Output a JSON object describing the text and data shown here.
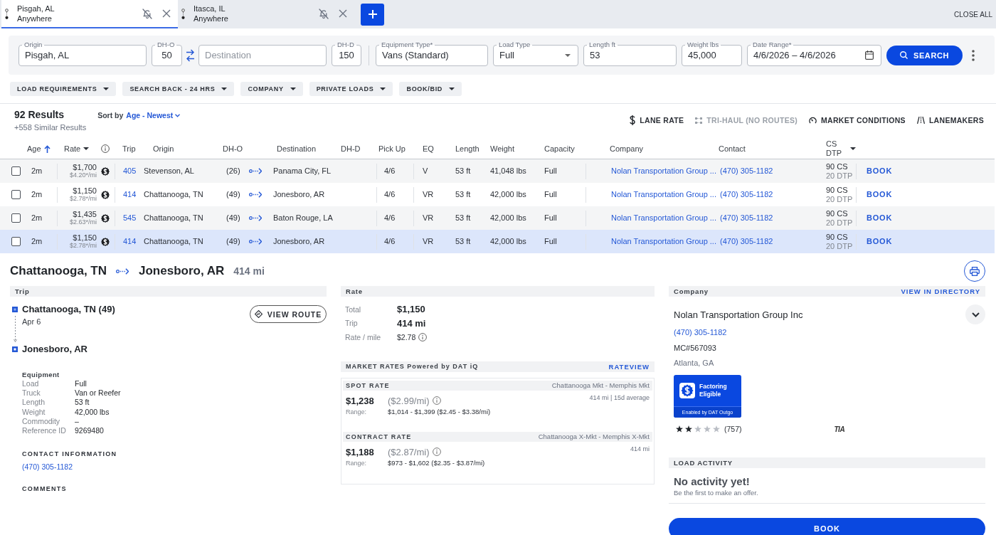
{
  "search_tabs": [
    {
      "origin": "Pisgah, AL",
      "destination": "Anywhere",
      "selected": true
    },
    {
      "origin": "Itasca, IL",
      "destination": "Anywhere",
      "selected": false
    }
  ],
  "close_all": "CLOSE ALL",
  "search_form": {
    "fields": [
      {
        "kind": "text",
        "label": "Origin",
        "value": "Pisgah, AL"
      },
      {
        "kind": "text",
        "label": "DH-O",
        "value": "50"
      },
      {
        "kind": "swap"
      },
      {
        "kind": "text",
        "placeholder": "Destination"
      },
      {
        "kind": "text",
        "label": "DH-D",
        "value": "150"
      },
      {
        "kind": "divider"
      },
      {
        "kind": "text",
        "label": "Equipment Type*",
        "value": "Vans (Standard)"
      },
      {
        "kind": "select",
        "label": "Load Type",
        "value": "Full"
      },
      {
        "kind": "text",
        "label": "Length ft",
        "value": "53"
      },
      {
        "kind": "text",
        "label": "Weight lbs",
        "value": "45,000"
      },
      {
        "kind": "date",
        "label": "Date Range*",
        "value": "4/6/2026 – 4/6/2026"
      }
    ],
    "search_button": "SEARCH"
  },
  "filters": [
    "LOAD REQUIREMENTS",
    "SEARCH BACK - 24 HRS",
    "COMPANY",
    "PRIVATE LOADS",
    "BOOK/BID"
  ],
  "results": {
    "count": "92 Results",
    "similar": "+558 Similar Results",
    "sort_label": "Sort by",
    "sort_value": "Age - Newest"
  },
  "tools": [
    {
      "kind": "dollar",
      "label": "LANE RATE",
      "disabled": false
    },
    {
      "kind": "trihaul",
      "label": "TRI-HAUL (NO ROUTES)",
      "disabled": true
    },
    {
      "kind": "gauge",
      "label": "MARKET CONDITIONS",
      "disabled": false
    },
    {
      "kind": "lanemakers",
      "label": "LANEMAKERS",
      "disabled": false
    }
  ],
  "table": {
    "columns": [
      {
        "label": "Age",
        "sorted": true,
        "dropdown": false
      },
      {
        "label": "Rate",
        "sorted": false,
        "dropdown": true
      },
      {
        "label": "Trip",
        "sorted": false,
        "dropdown": false
      },
      {
        "label": "Origin",
        "sorted": false,
        "dropdown": false
      },
      {
        "label": "DH-O",
        "sorted": false,
        "dropdown": false
      },
      {
        "label": "Destination",
        "sorted": false,
        "dropdown": false
      },
      {
        "label": "DH-D",
        "sorted": false,
        "dropdown": false
      },
      {
        "label": "Pick Up",
        "sorted": false,
        "dropdown": false
      },
      {
        "label": "EQ",
        "sorted": false,
        "dropdown": false
      },
      {
        "label": "Length",
        "sorted": false,
        "dropdown": false
      },
      {
        "label": "Weight",
        "sorted": false,
        "dropdown": false
      },
      {
        "label": "Capacity",
        "sorted": false,
        "dropdown": false
      },
      {
        "label": "Company",
        "sorted": false,
        "dropdown": false
      },
      {
        "label": "Contact",
        "sorted": false,
        "dropdown": false
      },
      {
        "label": "CS DTP",
        "sorted": false,
        "dropdown": true
      }
    ],
    "rows": [
      {
        "selected": false,
        "checked": false,
        "age": "2m",
        "rate": "$1,700",
        "rate_per_mile": "$4.20*/mi",
        "factoring_eligible": true,
        "trip": "405",
        "origin": "Stevenson, AL",
        "dh_o": "(26)",
        "destination": "Panama City, FL",
        "pick_up": "4/6",
        "eq": "V",
        "length": "53 ft",
        "weight": "41,048 lbs",
        "capacity": "Full",
        "company": "Nolan Transportation Group ...",
        "contact": "(470) 305-1182",
        "cs": "90 CS",
        "dtp": "20 DTP",
        "action": "BOOK"
      },
      {
        "selected": false,
        "checked": false,
        "age": "2m",
        "rate": "$1,150",
        "rate_per_mile": "$2.78*/mi",
        "factoring_eligible": true,
        "trip": "414",
        "origin": "Chattanooga, TN",
        "dh_o": "(49)",
        "destination": "Jonesboro, AR",
        "pick_up": "4/6",
        "eq": "VR",
        "length": "53 ft",
        "weight": "42,000 lbs",
        "capacity": "Full",
        "company": "Nolan Transportation Group ...",
        "contact": "(470) 305-1182",
        "cs": "90 CS",
        "dtp": "20 DTP",
        "action": "BOOK"
      },
      {
        "selected": false,
        "checked": false,
        "age": "2m",
        "rate": "$1,435",
        "rate_per_mile": "$2.63*/mi",
        "factoring_eligible": true,
        "trip": "545",
        "origin": "Chattanooga, TN",
        "dh_o": "(49)",
        "destination": "Baton Rouge, LA",
        "pick_up": "4/6",
        "eq": "VR",
        "length": "53 ft",
        "weight": "42,000 lbs",
        "capacity": "Full",
        "company": "Nolan Transportation Group ...",
        "contact": "(470) 305-1182",
        "cs": "90 CS",
        "dtp": "20 DTP",
        "action": "BOOK"
      },
      {
        "selected": true,
        "checked": false,
        "age": "2m",
        "rate": "$1,150",
        "rate_per_mile": "$2.78*/mi",
        "factoring_eligible": true,
        "trip": "414",
        "origin": "Chattanooga, TN",
        "dh_o": "(49)",
        "destination": "Jonesboro, AR",
        "pick_up": "4/6",
        "eq": "VR",
        "length": "53 ft",
        "weight": "42,000 lbs",
        "capacity": "Full",
        "company": "Nolan Transportation Group ...",
        "contact": "(470) 305-1182",
        "cs": "90 CS",
        "dtp": "20 DTP",
        "action": "BOOK"
      }
    ]
  },
  "detail": {
    "origin": "Chattanooga, TN",
    "destination": "Jonesboro, AR",
    "distance": "414 mi",
    "trip": {
      "title": "Trip",
      "stops": [
        {
          "name": "Chattanooga, TN (49)",
          "date": "Apr 6"
        },
        {
          "name": "Jonesboro, AR"
        }
      ],
      "view_route_button": "VIEW ROUTE",
      "equipment_title": "Equipment",
      "equipment": [
        {
          "label": "Load",
          "value": "Full"
        },
        {
          "label": "Truck",
          "value": "Van or Reefer"
        },
        {
          "label": "Length",
          "value": "53 ft"
        },
        {
          "label": "Weight",
          "value": "42,000 lbs"
        },
        {
          "label": "Commodity",
          "value": "–"
        },
        {
          "label": "Reference ID",
          "value": "9269480"
        }
      ],
      "contact_title": "CONTACT INFORMATION",
      "contact_phone": "(470) 305-1182",
      "comments_title": "COMMENTS"
    },
    "rate": {
      "title": "Rate",
      "summary": [
        {
          "label": "Total",
          "value": "$1,150",
          "emphasis": true,
          "info": false
        },
        {
          "label": "Trip",
          "value": "414 mi",
          "emphasis": true,
          "info": false
        },
        {
          "label": "Rate / mile",
          "value": "$2.78",
          "emphasis": false,
          "info": true
        }
      ],
      "market_title": "MARKET RATES Powered by DAT iQ",
      "market_link": "RATEVIEW",
      "market_rates": [
        {
          "title": "SPOT RATE",
          "market": "Chattanooga Mkt - Memphis Mkt",
          "amount": "$1,238",
          "per_mile": "($2.99/mi)",
          "basis": "414 mi | 15d average",
          "range_label": "Range:",
          "range": "$1,014 - $1,399 ($2.45 - $3.38/mi)"
        },
        {
          "title": "CONTRACT RATE",
          "market": "Chattanooga X-Mkt - Memphis X-Mkt",
          "amount": "$1,188",
          "per_mile": "($2.87/mi)",
          "basis": "414 mi",
          "range_label": "Range:",
          "range": "$973 - $1,602 ($2.35 - $3.87/mi)"
        }
      ]
    },
    "company": {
      "title": "Company",
      "directory_link": "VIEW IN DIRECTORY",
      "name": "Nolan Transportation Group Inc",
      "phone": "(470) 305-1182",
      "mc": "MC#567093",
      "location": "Atlanta, GA",
      "factoring": {
        "title": "Factoring Eligible",
        "subtitle": "Enabled by DAT Outgo"
      },
      "stars": 2,
      "reviews": "(757)",
      "tia_logo": "TIA"
    },
    "load_activity": {
      "title": "LOAD ACTIVITY",
      "headline": "No activity yet!",
      "message": "Be the first to make an offer."
    },
    "book_button": "BOOK"
  }
}
